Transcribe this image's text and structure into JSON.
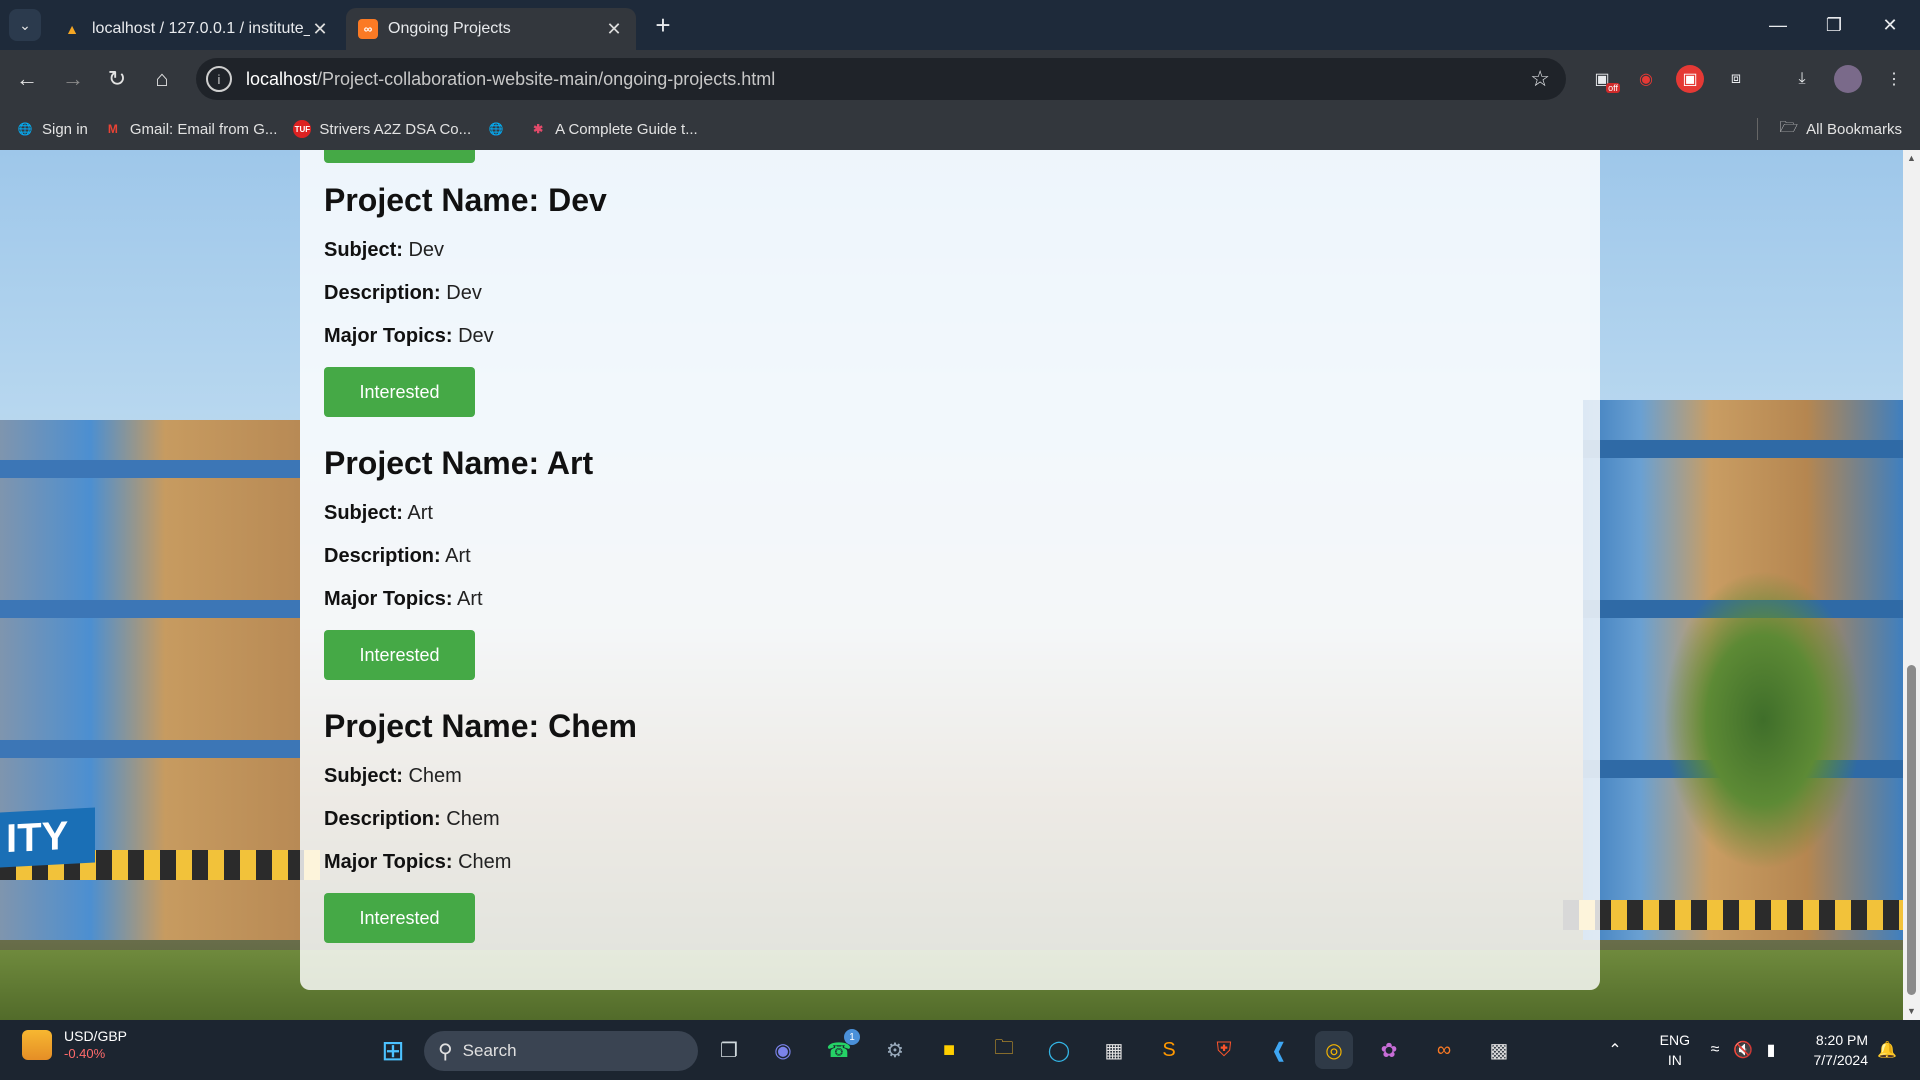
{
  "browser": {
    "tabs": [
      {
        "title": "localhost / 127.0.0.1 / institute_",
        "active": false
      },
      {
        "title": "Ongoing Projects",
        "active": true
      }
    ],
    "new_tab_label": "+",
    "url_host": "localhost",
    "url_path": "/Project-collaboration-website-main/ongoing-projects.html",
    "extension_badge": "off",
    "bookmarks": [
      {
        "label": "Sign in",
        "icon": "globe-icon"
      },
      {
        "label": "Gmail: Email from G...",
        "icon": "gmail-icon"
      },
      {
        "label": "Strivers A2Z DSA Co...",
        "icon": "tuf-icon"
      },
      {
        "label": "",
        "icon": "globe-icon"
      },
      {
        "label": "A Complete Guide t...",
        "icon": "asterisk-icon"
      }
    ],
    "all_bookmarks_label": "All Bookmarks"
  },
  "page": {
    "button_label": "Interested",
    "labels": {
      "name": "Project Name: ",
      "subject": "Subject:",
      "description": "Description:",
      "major_topics": "Major Topics:"
    },
    "projects": [
      {
        "name": "Dev",
        "subject": "Dev",
        "description": "Dev",
        "major_topics": "Dev"
      },
      {
        "name": "Art",
        "subject": "Art",
        "description": "Art",
        "major_topics": "Art"
      },
      {
        "name": "Chem",
        "subject": "Chem",
        "description": "Chem",
        "major_topics": "Chem"
      }
    ],
    "background_sign_text": "ITY"
  },
  "taskbar": {
    "ticker_symbol": "USD/GBP",
    "ticker_change": "-0.40%",
    "search_label": "Search",
    "whatsapp_badge": "1",
    "lang_top": "ENG",
    "lang_bottom": "IN",
    "time": "8:20 PM",
    "date": "7/7/2024"
  },
  "colors": {
    "button_green": "#45a946",
    "tab_bar": "#1e2a3a",
    "toolbar": "#33373d",
    "taskbar": "#1c2530"
  }
}
